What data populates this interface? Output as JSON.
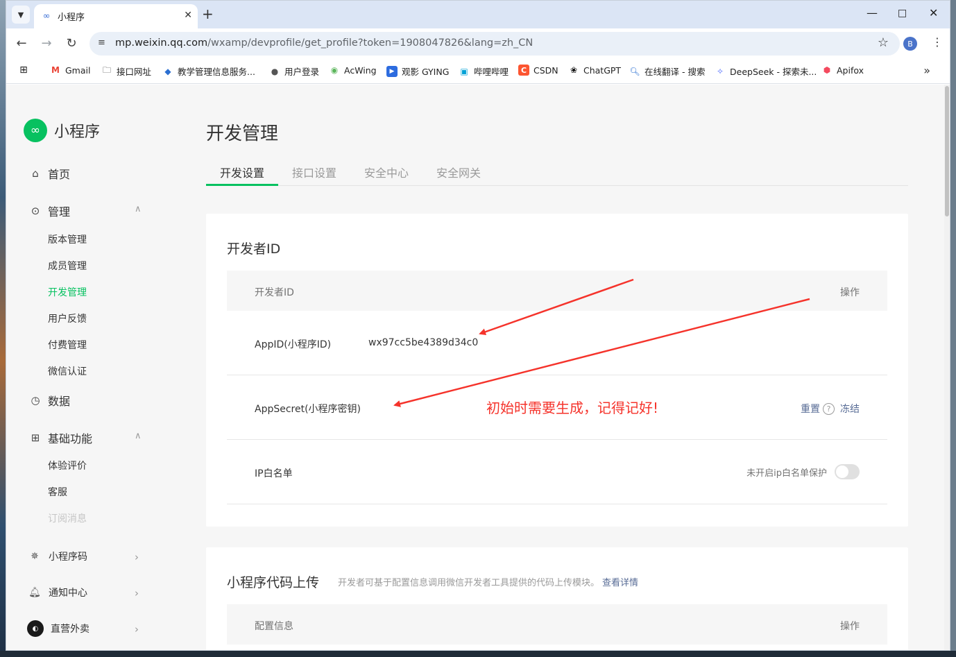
{
  "browser": {
    "tab_title": "小程序",
    "url_host": "mp.weixin.qq.com",
    "url_path": "/wxamp/devprofile/get_profile?token=1908047826&lang=zh_CN",
    "profile_initial": "B",
    "bookmarks": [
      {
        "label": "",
        "icon": "apps-grid-icon"
      },
      {
        "label": "Gmail",
        "icon": "gmail-icon",
        "color": "#ea4335"
      },
      {
        "label": "接口网址",
        "icon": "folder-icon"
      },
      {
        "label": "教学管理信息服务...",
        "icon": "edu-icon",
        "color": "#2a6fd1"
      },
      {
        "label": "用户登录",
        "icon": "globe-icon"
      },
      {
        "label": "AcWing",
        "icon": "acwing-icon",
        "color": "#5bb55b"
      },
      {
        "label": "观影 GYING",
        "icon": "play-icon",
        "color": "#2d6cdf"
      },
      {
        "label": "哔哩哔哩",
        "icon": "bilibili-icon",
        "color": "#00a1d6"
      },
      {
        "label": "CSDN",
        "icon": "csdn-icon",
        "color": "#fc5531"
      },
      {
        "label": "ChatGPT",
        "icon": "chatgpt-icon",
        "color": "#111111"
      },
      {
        "label": "在线翻译 - 搜索",
        "icon": "search-icon",
        "color": "#2a6fd1"
      },
      {
        "label": "DeepSeek - 探索未...",
        "icon": "deepseek-icon",
        "color": "#4d6bfe"
      },
      {
        "label": "Apifox",
        "icon": "apifox-icon",
        "color": "#f44a5f"
      }
    ]
  },
  "sidebar": {
    "brand": "小程序",
    "home": "首页",
    "manage": "管理",
    "manage_items": [
      "版本管理",
      "成员管理",
      "开发管理",
      "用户反馈",
      "付费管理",
      "微信认证"
    ],
    "data": "数据",
    "basic": "基础功能",
    "basic_items": [
      "体验评价",
      "客服",
      "订阅消息"
    ],
    "qrcode": "小程序码",
    "notify": "通知中心",
    "account": "直营外卖"
  },
  "main": {
    "title": "开发管理",
    "tabs": [
      "开发设置",
      "接口设置",
      "安全中心",
      "安全网关"
    ],
    "dev_card": {
      "title": "开发者ID",
      "col_id": "开发者ID",
      "col_op": "操作",
      "appid_label": "AppID(小程序ID)",
      "appid_value": "wx97cc5be4389d34c0",
      "secret_label": "AppSecret(小程序密钥)",
      "secret_reset": "重置",
      "secret_help": "?",
      "secret_freeze": "冻结",
      "annotation": "初始时需要生成，记得记好!",
      "annotation_color": "#f5332b",
      "ip_label": "IP白名单",
      "ip_toggle_text": "未开启ip白名单保护"
    },
    "upload_card": {
      "title": "小程序代码上传",
      "subtitle": "开发者可基于配置信息调用微信开发者工具提供的代码上传模块。",
      "detail_link": "查看详情",
      "col_config": "配置信息",
      "col_op": "操作"
    }
  },
  "colors": {
    "accent": "#07c160",
    "link": "#576b95",
    "annotation": "#f5332b"
  }
}
